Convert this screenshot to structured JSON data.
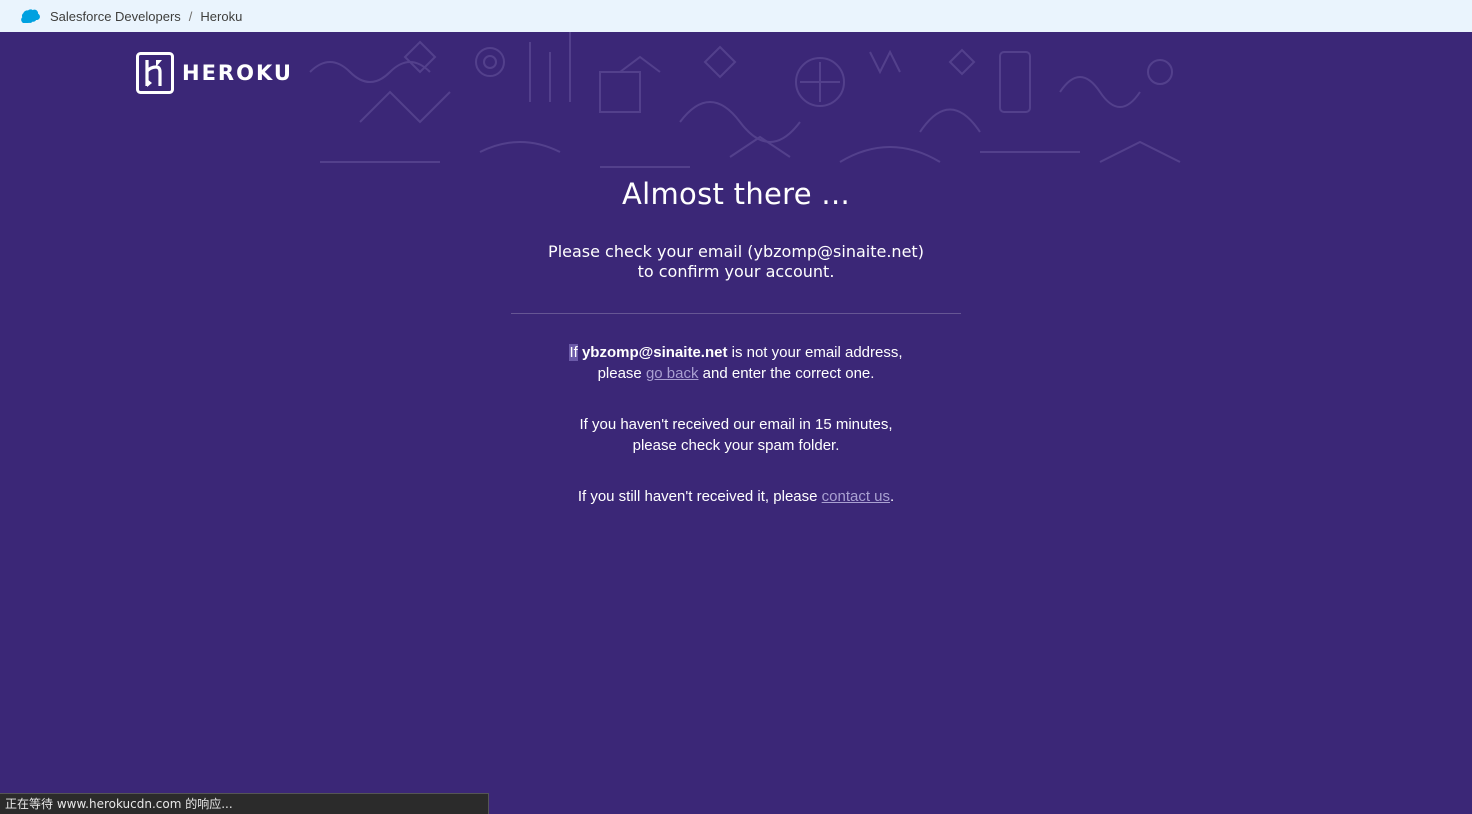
{
  "breadcrumb": {
    "items": [
      {
        "label": "Salesforce Developers"
      },
      {
        "label": "Heroku"
      }
    ],
    "separator": "/"
  },
  "brand": {
    "wordmark": "HEROKU",
    "color": "#3b2777"
  },
  "main": {
    "title": "Almost there ...",
    "lead_line1": "Please check your email (ybzomp@sinaite.net)",
    "lead_line2": "to confirm your account.",
    "p1_if": "If",
    "p1_email": "ybzomp@sinaite.net",
    "p1_rest": " is not your email address,",
    "p1_please": "please ",
    "p1_link": "go back",
    "p1_end": " and enter the correct one.",
    "p2_line1": "If you haven't received our email in 15 minutes,",
    "p2_line2": "please check your spam folder.",
    "p3_text": "If you still haven't received it, please ",
    "p3_link": "contact us",
    "p3_end": "."
  },
  "status": {
    "text": "正在等待 www.herokucdn.com 的响应..."
  }
}
